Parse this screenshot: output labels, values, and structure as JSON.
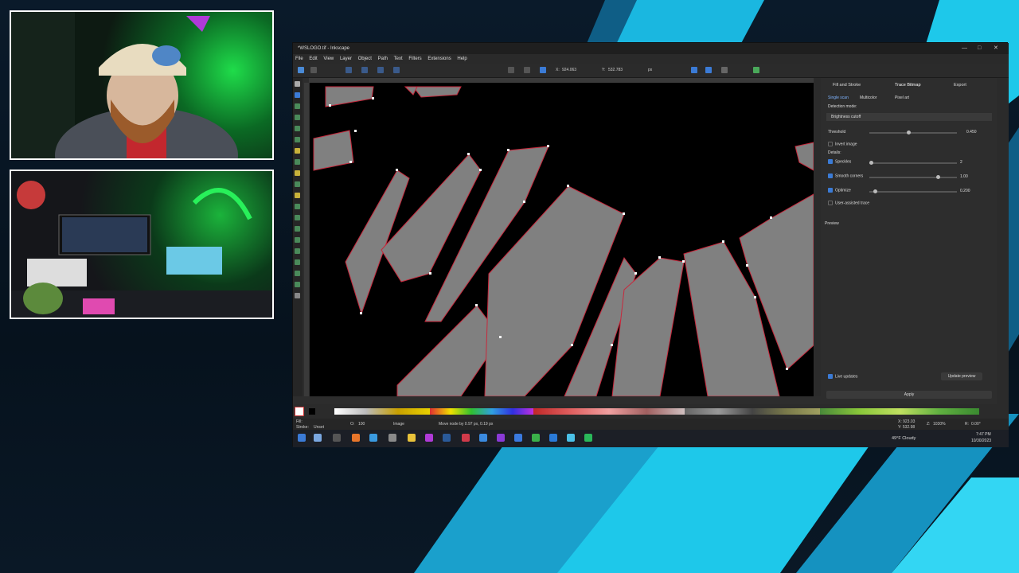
{
  "window": {
    "title": "*WSLOGO.tif - Inkscape",
    "menu": [
      "File",
      "Edit",
      "View",
      "Layer",
      "Object",
      "Path",
      "Text",
      "Filters",
      "Extensions",
      "Help"
    ]
  },
  "toolbar": {
    "x_label": "X:",
    "x_value": "924.063",
    "y_label": "Y:",
    "y_value": "532.783",
    "unit": "px"
  },
  "panel": {
    "tabs": [
      "Fill and Stroke",
      "Trace Bitmap",
      "Export"
    ],
    "subtabs": [
      "Single scan",
      "Multicolor",
      "Pixel art"
    ],
    "detection_mode_label": "Detection mode:",
    "detection_mode_value": "Brightness cutoff",
    "threshold_label": "Threshold",
    "threshold_value": "0.450",
    "invert_label": "Invert image",
    "details_label": "Details:",
    "speckles_label": "Speckles",
    "speckles_value": "2",
    "smooth_label": "Smooth corners",
    "smooth_value": "1.00",
    "optimize_label": "Optimize",
    "optimize_value": "0.200",
    "user_trace_label": "User-assisted trace",
    "preview_label": "Preview",
    "live_updates_label": "Live updates",
    "update_preview_label": "Update preview",
    "apply_label": "Apply",
    "threshold_level": 0.45,
    "smooth_level": 0.8,
    "optimize_level": 0.05
  },
  "status": {
    "fill_label": "Fill:",
    "stroke_label": "Stroke:",
    "stroke_value": "Unset",
    "opacity_label": "O:",
    "opacity_value": "100",
    "layer_value": "Image",
    "message": "Move node by 0.97 px, 0.19 px",
    "x_coord": "X: 923.03",
    "y_coord": "Y: 532.98",
    "zoom_label": "Z:",
    "zoom_value": "1030%",
    "rotate_label": "R:",
    "rotate_value": "0.00°"
  },
  "taskbar": {
    "weather": "49°F Cloudy",
    "time": "7:47 PM",
    "date": "10/30/2023"
  },
  "colors": {
    "accent": "#3b7bd6",
    "brand_cyan": "#1ec8ea",
    "canvas": "#000000",
    "shape_fill": "#808080",
    "path_stroke": "#c8283c"
  }
}
